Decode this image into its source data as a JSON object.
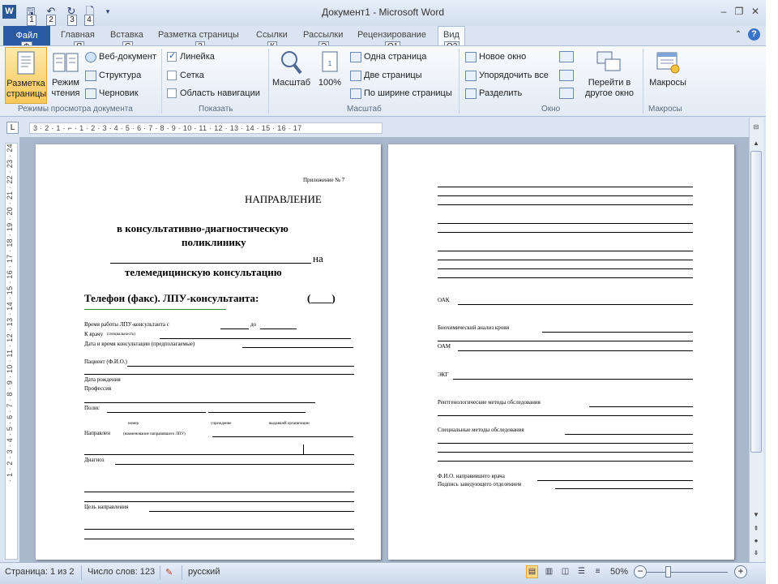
{
  "titlebar": {
    "title": "Документ1 - Microsoft Word",
    "app_icon": "W",
    "qat_keytips": [
      "1",
      "2",
      "3",
      "4"
    ],
    "controls": {
      "minimize": "–",
      "restore": "❐",
      "close": "✕"
    }
  },
  "tabs": {
    "file": "Файл",
    "items": [
      "Главная",
      "Вставка",
      "Разметка страницы",
      "Ссылки",
      "Рассылки",
      "Рецензирование",
      "Вид"
    ],
    "active": "Вид",
    "keytips": [
      "Ф",
      "Я",
      "С",
      "З",
      "К",
      "Э",
      "О1",
      "О2"
    ]
  },
  "ribbon": {
    "groups": {
      "views": {
        "label": "Режимы просмотра документа",
        "print_layout": "Разметка страницы",
        "reading": "Режим чтения",
        "web": "Веб-документ",
        "outline": "Структура",
        "draft": "Черновик"
      },
      "show": {
        "label": "Показать",
        "ruler": "Линейка",
        "ruler_checked": true,
        "grid": "Сетка",
        "grid_checked": false,
        "nav": "Область навигации",
        "nav_checked": false
      },
      "zoom": {
        "label": "Масштаб",
        "zoom": "Масштаб",
        "hundred": "100%",
        "one_page": "Одна страница",
        "two_pages": "Две страницы",
        "page_width": "По ширине страницы"
      },
      "window": {
        "label": "Окно",
        "new_window": "Новое окно",
        "arrange_all": "Упорядочить все",
        "split": "Разделить",
        "switch": "Перейти в другое окно"
      },
      "macros": {
        "label": "Макросы",
        "macros": "Макросы"
      }
    }
  },
  "ruler": {
    "horizontal": "3 · 2 · 1 · ⌐ · 1 · 2 · 3 · 4 · 5 · 6 · 7 · 8 · 9 · 10 · 11 · 12 · 13 · 14 · 15 · 16 · 17",
    "vertical": "· 1 · 2 · 3 · 4 · 5 · 6 · 7 · 8 · 9 · 10 · 11 · 12 · 13 · 14 · 15 · 16 · 17 · 18 · 19 · 20 · 21 · 22 · 23 · 24"
  },
  "page1": {
    "appendix": "Приложение № 7",
    "heading": "НАПРАВЛЕНИЕ",
    "line1": "в консультативно-диагностическую",
    "line2": "поликлинику",
    "line3_suffix": "на",
    "line4": "телемедицинскую консультацию",
    "phone": "Телефон (факс). ЛПУ-консультанта:",
    "phone_blank": "(____)",
    "hours": "Время работы ЛПУ-консультанта с",
    "hours_to": "до",
    "to_doctor": "К врачу",
    "to_doctor_small": "(специальность)",
    "date_time": "Дата и время консультации (предполагаемые)",
    "patient": "Пациент (Ф.И.О.)",
    "birthdate": "Дата рождения",
    "profession": "Профессия",
    "policy": "Полис",
    "small_labels": [
      "номер",
      "учреждение",
      "выдавшей организации"
    ],
    "referred": "Направлен",
    "referred_small": "(наименование направившего ЛПУ)",
    "diagnosis": "Диагноз",
    "purpose": "Цель направления"
  },
  "page2": {
    "oak": "ОАК",
    "biochem": "Биохимический анализ крови",
    "oam": "ОАМ",
    "ecg": "ЭКГ",
    "xray": "Рентгенологические методы обследования",
    "special": "Специальные методы обследования",
    "doctor": "Ф.И.О. направившего врача",
    "head_signature": "Подпись заведующего отделением"
  },
  "statusbar": {
    "page": "Страница: 1 из 2",
    "words": "Число слов: 123",
    "language": "русский",
    "zoom": "50%"
  },
  "colors": {
    "file_tab": "#2a5aa3",
    "ribbon_bg": "#e2eaf4",
    "workspace_bg": "#aab8cc",
    "active_view": "#f7c75b"
  }
}
